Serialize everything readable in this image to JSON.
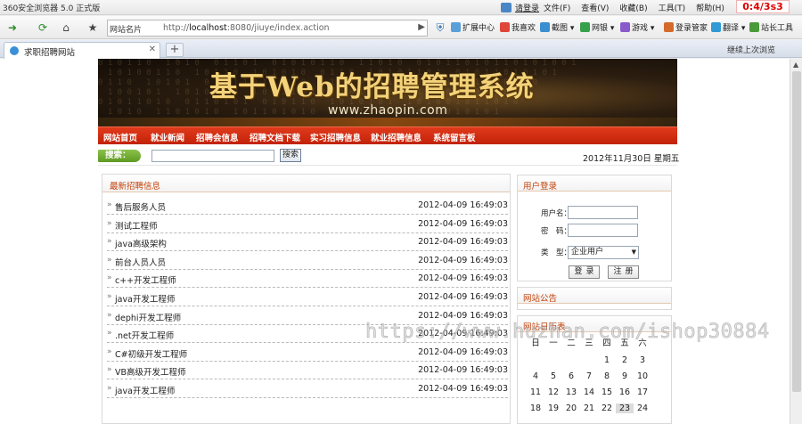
{
  "browser": {
    "app_title": "360安全浏览器 5.0 正式版",
    "login_link": "请登录",
    "menu": [
      "文件(F)",
      "查看(V)",
      "收藏(B)",
      "工具(T)",
      "帮助(H)"
    ],
    "timer": "0:4/3s3",
    "site_selector": "网站名片",
    "url_prefix": "http://",
    "url_host": "localhost",
    "url_rest": ":8080/jiuye/index.action",
    "toolbar": [
      "扩展中心",
      "我喜欢",
      "截图",
      "网银",
      "游戏",
      "登录管家",
      "翻译",
      "站长工具"
    ],
    "tab_title": "求职招聘网站",
    "restore_label": "继续上次浏览"
  },
  "site": {
    "banner_title": "基于Web的招聘管理系统",
    "banner_domain": "www.zhaopin.com",
    "nav": [
      "网站首页",
      "就业新闻",
      "招聘会信息",
      "招聘文档下载",
      "实习招聘信息",
      "就业招聘信息",
      "系统留言板"
    ],
    "search_label": "搜索：",
    "search_button": "搜索",
    "search_value": "",
    "date": "2012年11月30日 星期五"
  },
  "jobs": {
    "title": "最新招聘信息",
    "items": [
      {
        "title": "售后服务人员",
        "date": "2012-04-09 16:49:03"
      },
      {
        "title": "测试工程师",
        "date": "2012-04-09 16:49:03"
      },
      {
        "title": "java高级架构",
        "date": "2012-04-09 16:49:03"
      },
      {
        "title": "前台人员人员",
        "date": "2012-04-09 16:49:03"
      },
      {
        "title": "c++开发工程师",
        "date": "2012-04-09 16:49:03"
      },
      {
        "title": "java开发工程师",
        "date": "2012-04-09 16:49:03"
      },
      {
        "title": "dephi开发工程师",
        "date": "2012-04-09 16:49:03"
      },
      {
        "title": ".net开发工程师",
        "date": "2012-04-09 16:49:03"
      },
      {
        "title": "C#初级开发工程师",
        "date": "2012-04-09 16:49:03"
      },
      {
        "title": "VB高级开发工程师",
        "date": "2012-04-09 16:49:03"
      },
      {
        "title": "java开发工程师",
        "date": "2012-04-09 16:49:03"
      }
    ]
  },
  "login": {
    "title": "用户登录",
    "username_label": "用户名：",
    "password_label": "密　码：",
    "type_label": "类　型：",
    "type_value": "企业用户",
    "login_button": "登录",
    "register_button": "注册"
  },
  "notice": {
    "title": "网站公告"
  },
  "calendar": {
    "title": "网站日历表",
    "weekdays": [
      "日",
      "一",
      "二",
      "三",
      "四",
      "五",
      "六"
    ],
    "rows": [
      [
        "",
        "",
        "",
        "",
        "1",
        "2",
        "3"
      ],
      [
        "4",
        "5",
        "6",
        "7",
        "8",
        "9",
        "10"
      ],
      [
        "11",
        "12",
        "13",
        "14",
        "15",
        "16",
        "17"
      ],
      [
        "18",
        "19",
        "20",
        "21",
        "22",
        "23",
        "24"
      ]
    ],
    "today": "23"
  },
  "watermark": "https://www.huzhan.com/ishop30884"
}
